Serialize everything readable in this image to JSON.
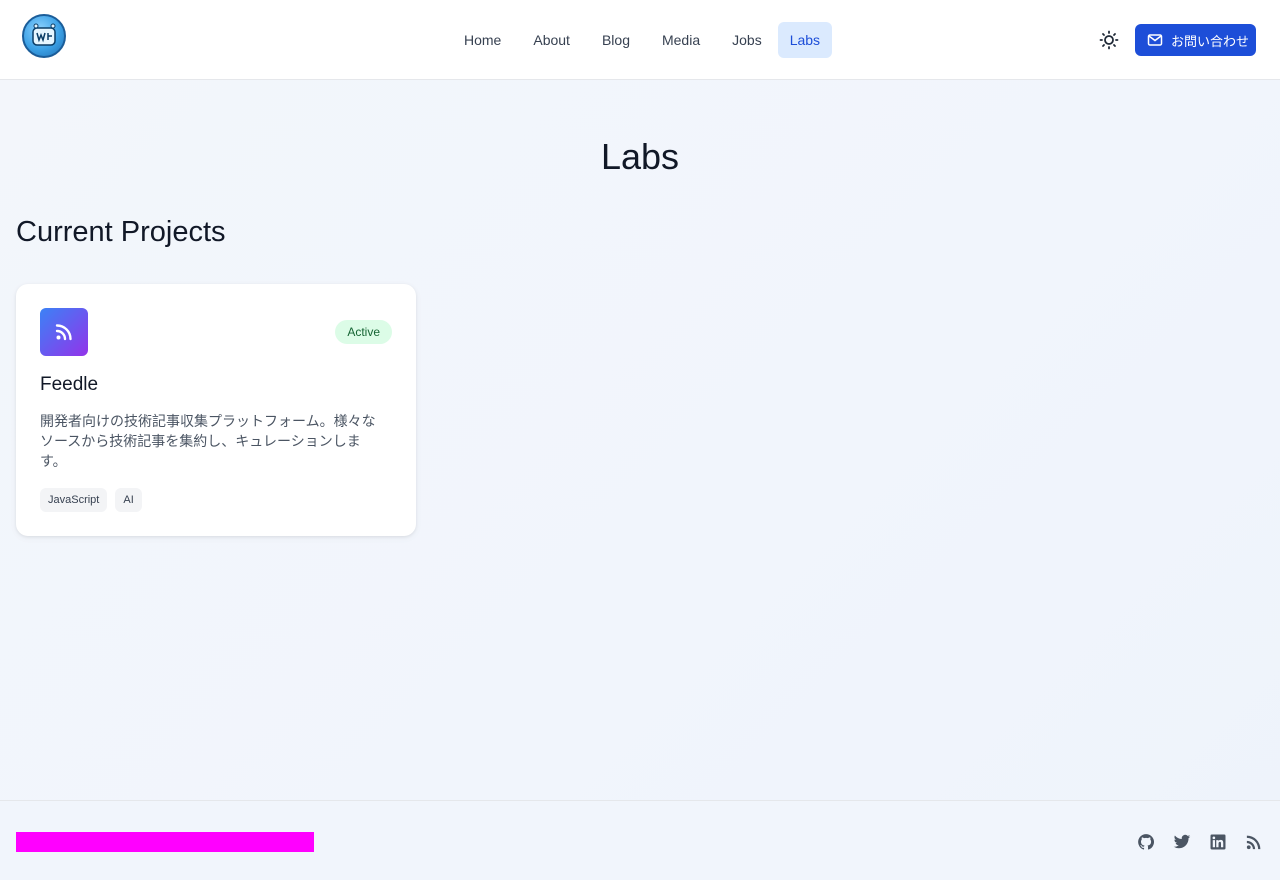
{
  "header": {
    "nav": [
      {
        "label": "Home",
        "active": false
      },
      {
        "label": "About",
        "active": false
      },
      {
        "label": "Blog",
        "active": false
      },
      {
        "label": "Media",
        "active": false
      },
      {
        "label": "Jobs",
        "active": false
      },
      {
        "label": "Labs",
        "active": true
      }
    ],
    "contact_label": "お問い合わせ",
    "theme_icon": "sun-icon",
    "contact_icon": "mail-icon",
    "logo_icon": "logo"
  },
  "main": {
    "title": "Labs",
    "section_title": "Current Projects",
    "projects": [
      {
        "name": "Feedle",
        "status": "Active",
        "icon": "rss-icon",
        "description": "開発者向けの技術記事収集プラットフォーム。様々なソースから技術記事を集約し、キュレーションします。",
        "tags": [
          "JavaScript",
          "AI"
        ]
      }
    ]
  },
  "footer": {
    "social_icons": [
      "github-icon",
      "twitter-icon",
      "linkedin-icon",
      "rss-icon"
    ]
  },
  "colors": {
    "accent": "#1d4ed8",
    "active_nav_bg": "#dbeafe",
    "badge_bg": "#dcfce7",
    "badge_text": "#166534",
    "footer_bar": "#ff00ff"
  }
}
